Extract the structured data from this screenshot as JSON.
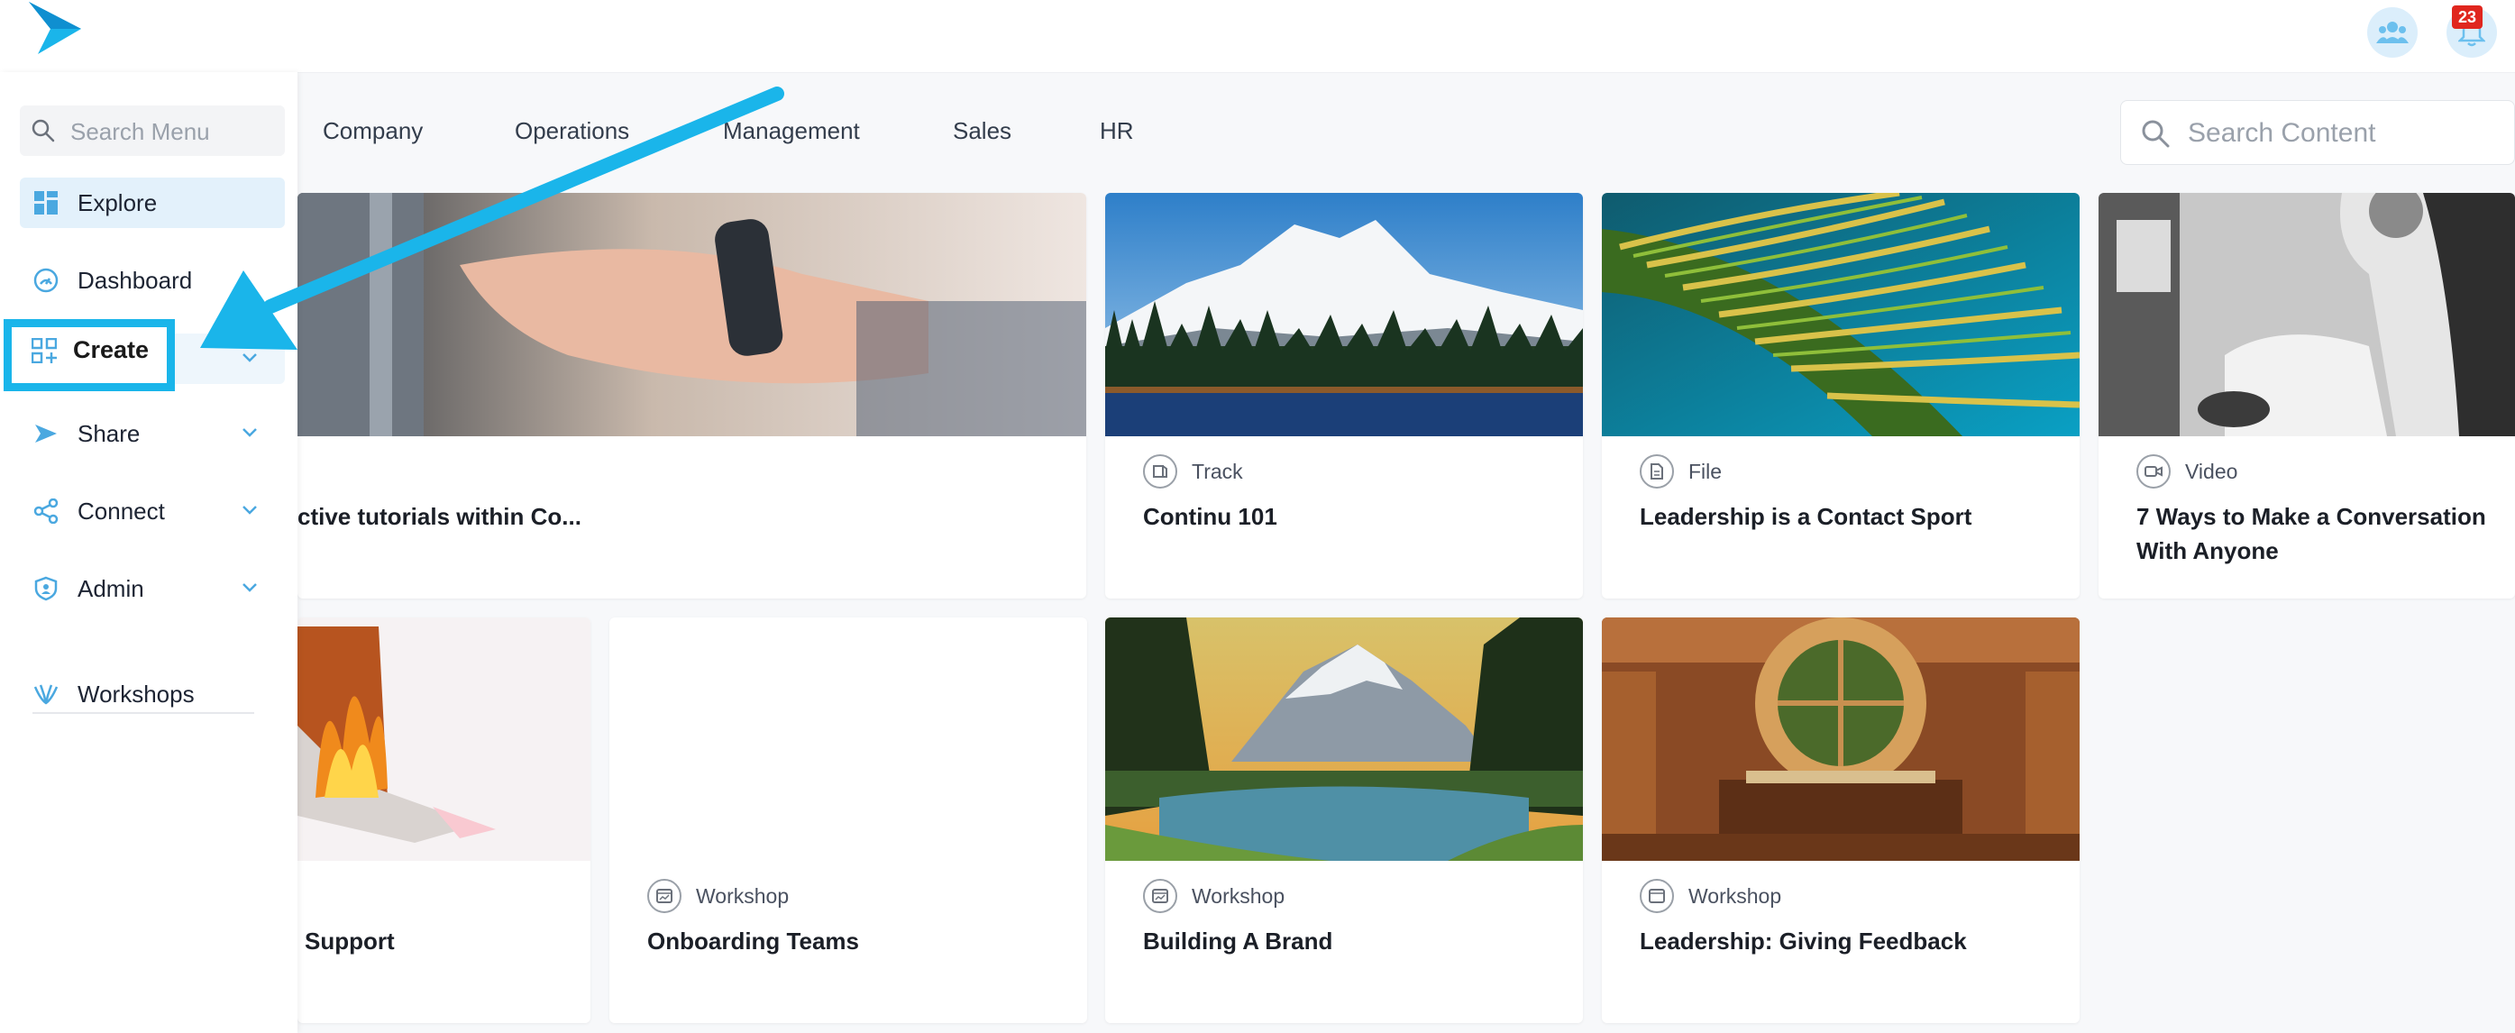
{
  "header": {
    "notifications_count": "23",
    "icons": [
      "logo-icon",
      "team-icon",
      "bell-icon"
    ]
  },
  "sidebar": {
    "search_placeholder": "Search Menu",
    "items": [
      {
        "label": "Explore",
        "icon": "explore-icon"
      },
      {
        "label": "Dashboard",
        "icon": "dashboard-icon"
      },
      {
        "label": "Create",
        "icon": "create-icon"
      },
      {
        "label": "Share",
        "icon": "share-icon"
      },
      {
        "label": "Connect",
        "icon": "connect-icon"
      },
      {
        "label": "Admin",
        "icon": "admin-icon"
      },
      {
        "label": "Workshops",
        "icon": "workshops-icon"
      }
    ]
  },
  "tabs": [
    "Company",
    "Operations",
    "Management",
    "Sales",
    "HR"
  ],
  "content_search": {
    "placeholder": "Search Content"
  },
  "cards": [
    {
      "type": "",
      "title": "ctive tutorials within Co..."
    },
    {
      "type": "Track",
      "title": "Continu 101"
    },
    {
      "type": "File",
      "title": "Leadership is a Contact Sport"
    },
    {
      "type": "Video",
      "title": "7 Ways to Make a Conversation With Anyone"
    },
    {
      "type": "",
      "title": "Support"
    },
    {
      "type": "Workshop",
      "title": "Onboarding Teams"
    },
    {
      "type": "Workshop",
      "title": "Building A Brand"
    },
    {
      "type": "Workshop",
      "title": "Leadership: Giving Feedback"
    }
  ],
  "colors": {
    "accent": "#1ab5ea",
    "explore_bg": "#e3f1fb",
    "badge": "#e0261e"
  }
}
